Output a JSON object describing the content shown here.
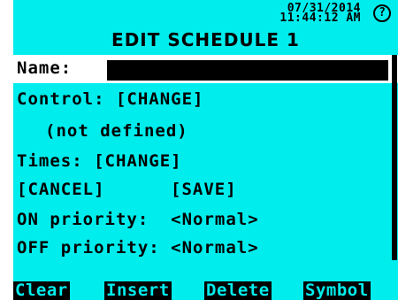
{
  "header": {
    "date": "07/31/2014",
    "time": "11:44:12 AM",
    "help_icon": "help-circle-icon",
    "title": "EDIT SCHEDULE 1"
  },
  "form": {
    "name_label": "Name:",
    "name_value": "",
    "control": "Control: [CHANGE]",
    "control_value": "(not defined)",
    "times": "Times: [CHANGE]",
    "cancel": "[CANCEL]",
    "save": "[SAVE]",
    "on_priority": "ON priority:  <Normal>",
    "off_priority": "OFF priority: <Normal>"
  },
  "softkeys": [
    "Clear",
    "Insert",
    "Delete",
    "Symbol"
  ],
  "colors": {
    "screen": "#00eded",
    "text": "#000000",
    "highlight": "#ffffff"
  }
}
